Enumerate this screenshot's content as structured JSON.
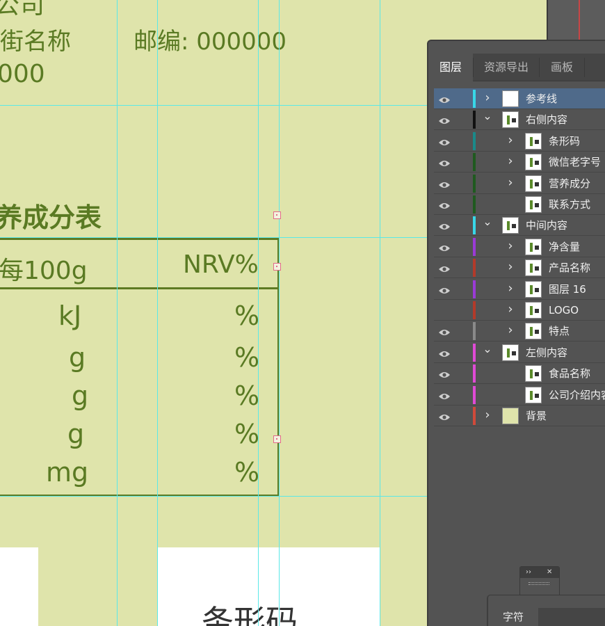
{
  "canvas": {
    "company_partial": "公司",
    "address_line": "街名称",
    "postcode": "邮编: 000000",
    "phone_partial": "000",
    "nutrition_title": "养成分表",
    "header_per100g": "每100g",
    "header_nrv": "NRV%",
    "rows": [
      {
        "unit": "kJ",
        "pct": "%"
      },
      {
        "unit": "g",
        "pct": "%"
      },
      {
        "unit": "g",
        "pct": "%"
      },
      {
        "unit": "g",
        "pct": "%"
      },
      {
        "unit": "mg",
        "pct": "%"
      }
    ],
    "barcode_label": "条形码"
  },
  "layers_panel": {
    "tabs": [
      "图层",
      "资源导出",
      "画板"
    ],
    "active_tab": "图层",
    "layers": [
      {
        "name": "参考线",
        "visible": true,
        "expanded": false,
        "color": "#38d7e8",
        "selected": true
      },
      {
        "name": "右侧内容",
        "visible": true,
        "expanded": true,
        "color": "#111111"
      },
      {
        "name": "条形码",
        "visible": true,
        "expanded": false,
        "color": "#1a8a8a"
      },
      {
        "name": "微信老字号",
        "visible": true,
        "expanded": false,
        "color": "#1f5a1f"
      },
      {
        "name": "营养成分",
        "visible": true,
        "expanded": false,
        "color": "#1f5a1f"
      },
      {
        "name": "联系方式",
        "visible": true,
        "expanded": false,
        "color": "#1f5a1f"
      },
      {
        "name": "中间内容",
        "visible": true,
        "expanded": true,
        "color": "#38d7e8"
      },
      {
        "name": "净含量",
        "visible": true,
        "expanded": false,
        "color": "#9a3ad6"
      },
      {
        "name": "产品名称",
        "visible": true,
        "expanded": false,
        "color": "#b33a2a"
      },
      {
        "name": "图层 16",
        "visible": true,
        "expanded": false,
        "color": "#9a3ad6"
      },
      {
        "name": "LOGO",
        "visible": false,
        "expanded": false,
        "color": "#b33a2a"
      },
      {
        "name": "特点",
        "visible": true,
        "expanded": false,
        "color": "#8a8a8a"
      },
      {
        "name": "左侧内容",
        "visible": true,
        "expanded": true,
        "color": "#e04ad6"
      },
      {
        "name": "食品名称",
        "visible": true,
        "expanded": false,
        "color": "#e04ad6"
      },
      {
        "name": "公司介绍内容",
        "visible": true,
        "expanded": false,
        "color": "#e04ad6"
      },
      {
        "name": "背景",
        "visible": true,
        "expanded": false,
        "color": "#d04a3a"
      }
    ]
  },
  "char_panel": {
    "tab": "字符"
  },
  "colors": {
    "canvas_bg": "#dfe4ab",
    "canvas_text": "#5a7a23",
    "guide": "#5ae8e8",
    "panel_bg": "#535353",
    "selection": "#4f6a8a"
  }
}
